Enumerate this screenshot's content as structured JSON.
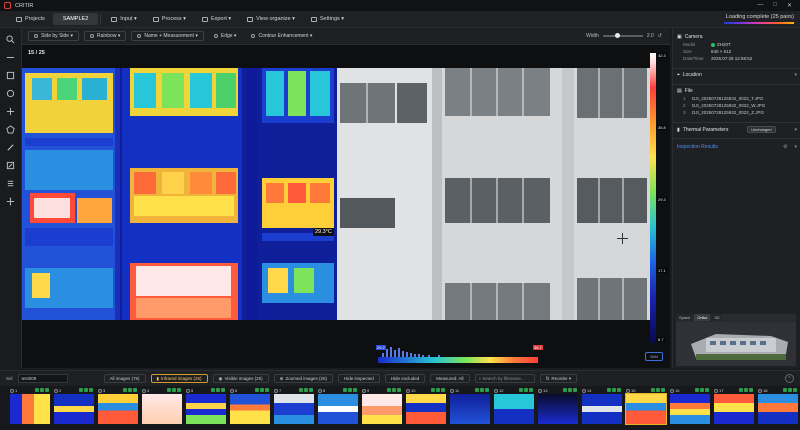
{
  "app": {
    "title": "CRITIR"
  },
  "menubar": {
    "projects": "Projects",
    "sample_tab": "SAMPLE2",
    "input": "Input ▾",
    "process": "Process ▾",
    "export": "Export ▾",
    "view": "View  organize ▾",
    "settings": "Settings ▾",
    "loading": "Loading complete (25 pairs)"
  },
  "viewbar": {
    "side_by_side": "Side by Side ▾",
    "palette": "Rainbow ▾",
    "name_measurement": "Name + Measurement ▾",
    "edge": "Edge ▾",
    "contour": "Contour Enhancement ▾",
    "width_label": "Width",
    "width_value": "2.0"
  },
  "viewer": {
    "counter": "15 / 25",
    "temp_readout": "29.3°C",
    "scale_labels": [
      "42.3",
      "35.8",
      "29.3",
      "17.1",
      "8.7"
    ],
    "hist_min": "29.2",
    "hist_max": "36.7",
    "blue_btn": "Grid"
  },
  "rightpanel": {
    "camera": {
      "title": "Camera",
      "model_k": "Model",
      "model_v": "ZH20T",
      "size_k": "Size",
      "size_v": "640 × 512",
      "date_k": "Date/Time",
      "date_v": "2025:07:28 12:59:52"
    },
    "location": {
      "title": "Location"
    },
    "file": {
      "title": "File",
      "files": [
        {
          "n": "1",
          "name": "DJI_20250728125932_0022_T.JPG"
        },
        {
          "n": "2",
          "name": "DJI_20250728125932_0022_W.JPG"
        },
        {
          "n": "3",
          "name": "DJI_20250728125932_0022_Z.JPG"
        }
      ]
    },
    "thermal": {
      "title": "Thermal Parameters",
      "badge": "Unchanged"
    },
    "inspection": {
      "title": "Inspection Results"
    },
    "map_tabs": [
      "Space",
      "Ortho",
      "3D"
    ]
  },
  "filterbar": {
    "sel_label": "Sel",
    "sel_value": "test009",
    "all": "All images (75)",
    "infrared": "Infrared images (25)",
    "visible": "Visible images (25)",
    "zoomed": "Zoomed images (25)",
    "hide_inspected": "Hide inspected",
    "hide_excluded": "Hide excluded",
    "measured": "Measured: All",
    "search_placeholder": "Search by filename...",
    "reorder": "Reorder ▾"
  },
  "thumbnails": [
    "1",
    "2",
    "3",
    "4",
    "5",
    "6",
    "7",
    "8",
    "9",
    "10",
    "11",
    "12",
    "13",
    "14",
    "15",
    "16",
    "17",
    "18"
  ],
  "colors": {
    "accent_blue": "#4f8df0",
    "selected_outline": "#e6b325",
    "status_green": "#26c06b"
  }
}
